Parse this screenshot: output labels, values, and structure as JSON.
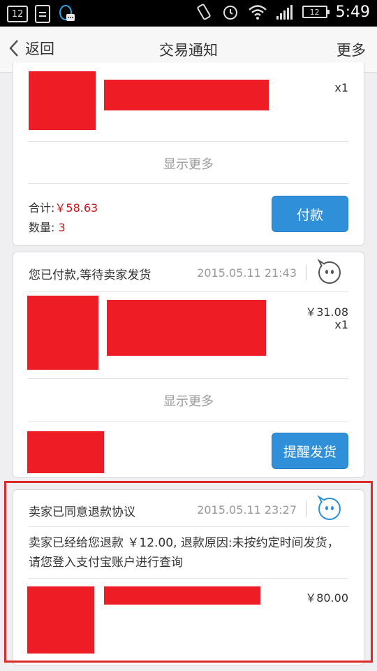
{
  "status_bar": {
    "notif_count": "12",
    "battery": "12",
    "time": "5:49"
  },
  "nav": {
    "back_label": "返回",
    "title": "交易通知",
    "more_label": "更多"
  },
  "card1": {
    "qty": "x1",
    "show_more": "显示更多",
    "total_label": "合计:",
    "total_value": "￥58.63",
    "count_label": "数量:",
    "count_value": "3",
    "pay_button": "付款"
  },
  "card2": {
    "title": "您已付款,等待卖家发货",
    "date": "2015.05.11 21:43",
    "price": "￥31.08",
    "qty": "x1",
    "show_more": "显示更多",
    "remind_button": "提醒发货"
  },
  "card3": {
    "title": "卖家已同意退款协议",
    "date": "2015.05.11 23:27",
    "message": "卖家已经给您退款 ￥12.00, 退款原因:未按约定时间发货，请您登入支付宝账户进行查询",
    "price": "￥80.00"
  },
  "colors": {
    "accent": "#2f8fd8",
    "redact": "#ee1c24",
    "price_red": "#c4161c",
    "highlight": "#dd2a2a"
  }
}
